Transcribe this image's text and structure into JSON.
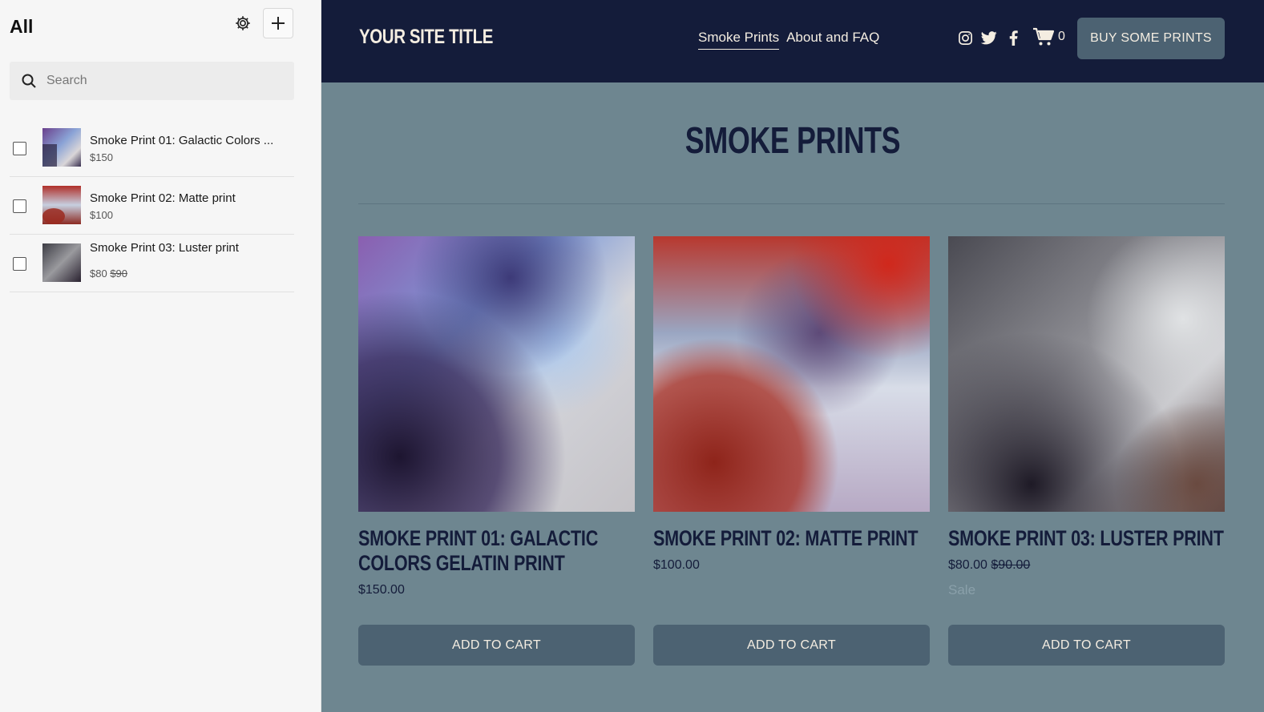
{
  "sidebar": {
    "title": "All",
    "search_placeholder": "Search",
    "items": [
      {
        "name": "Smoke Print 01: Galactic Colors ...",
        "price": "$150",
        "old_price": ""
      },
      {
        "name": "Smoke Print 02: Matte print",
        "price": "$100",
        "old_price": ""
      },
      {
        "name": "Smoke Print 03: Luster print",
        "price": "$80",
        "old_price": "$90"
      }
    ],
    "icons": {
      "settings": "gear-icon",
      "add": "plus-icon",
      "search": "search-icon"
    }
  },
  "site": {
    "logo": "YOUR SITE TITLE",
    "nav": [
      {
        "label": "Smoke Prints",
        "active": true
      },
      {
        "label": "About and FAQ",
        "active": false
      }
    ],
    "social_icons": [
      "instagram-icon",
      "twitter-icon",
      "facebook-icon"
    ],
    "cart_count": "0",
    "cta_label": "BUY SOME PRINTS",
    "page_title": "SMOKE PRINTS",
    "products": [
      {
        "name": "SMOKE PRINT 01: GALACTIC COLORS GELATIN PRINT",
        "price": "$150.00",
        "old_price": "",
        "badge": "",
        "button": "ADD TO CART"
      },
      {
        "name": "SMOKE PRINT 02: MATTE PRINT",
        "price": "$100.00",
        "old_price": "",
        "badge": "",
        "button": "ADD TO CART"
      },
      {
        "name": "SMOKE PRINT 03: LUSTER PRINT",
        "price": "$80.00",
        "old_price": "$90.00",
        "badge": "Sale",
        "button": "ADD TO CART"
      }
    ]
  },
  "colors": {
    "header_bg": "#141c3a",
    "page_bg": "#6e8690",
    "button_bg": "#4c6272",
    "text_light": "#f4ede1"
  }
}
